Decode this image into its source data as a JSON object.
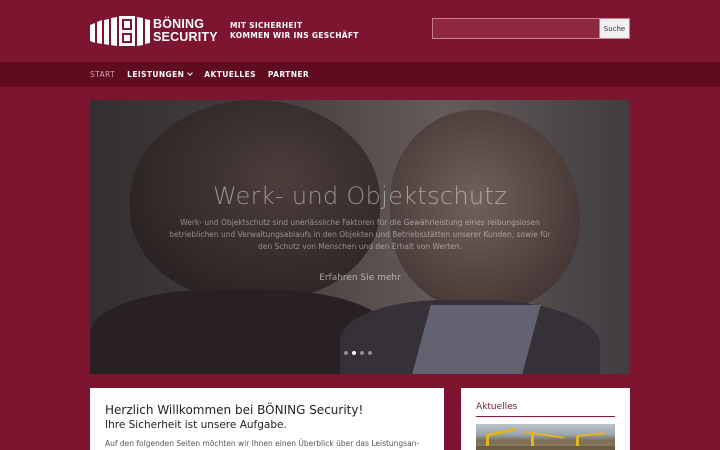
{
  "header": {
    "logo_line1": "BÖNING",
    "logo_line2": "SECURITY",
    "tagline_line1": "MIT SICHERHEIT",
    "tagline_line2": "KOMMEN WIR INS GESCHÄFT",
    "search": {
      "value": "",
      "placeholder": "",
      "button_label": "Suche"
    }
  },
  "nav": {
    "items": [
      {
        "label": "START",
        "active": true,
        "dropdown": false
      },
      {
        "label": "LEISTUNGEN",
        "active": false,
        "dropdown": true
      },
      {
        "label": "AKTUELLES",
        "active": false,
        "dropdown": false
      },
      {
        "label": "PARTNER",
        "active": false,
        "dropdown": false
      }
    ]
  },
  "hero": {
    "title": "Werk- und Objektschutz",
    "text": "Werk- und Objektschutz sind unerlässliche Faktoren für die Gewährleistung eines reibungslosen betrieblichen und Verwaltungsablaufs in den Objekten und Betriebsstätten unserer Kunden, sowie für den Schutz von Menschen und den Erhalt von Werten.",
    "cta": "Erfahren Sie mehr",
    "slides_count": 4,
    "active_slide": 1
  },
  "welcome": {
    "heading": "Herzlich Willkommen bei BÖNING Security!",
    "subheading": "Ihre Sicherheit ist unsere Aufgabe.",
    "text": "Auf den folgenden Seiten möchten wir Ihnen einen Überblick über das Leistungsan-"
  },
  "aktuelles": {
    "title": "Aktuelles"
  },
  "colors": {
    "brand": "#7d1530",
    "nav_bg": "#5f0c20",
    "accent_text": "#8e1b34"
  }
}
